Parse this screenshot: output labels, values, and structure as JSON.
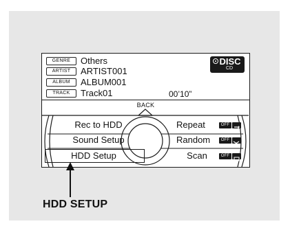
{
  "track_info": {
    "genre_tag": "GENRE",
    "genre": "Others",
    "artist_tag": "ARTIST",
    "artist": "ARTIST001",
    "album_tag": "ALBUM",
    "album": "ALBUM001",
    "track_tag": "TRACK",
    "track": "Track01",
    "time": "00’10”"
  },
  "source_badge": {
    "label": "DISC",
    "sub": "CD",
    "icon": "disc-icon"
  },
  "back_label": "BACK",
  "menu_left": [
    {
      "label": "Rec to HDD"
    },
    {
      "label": "Sound Setup"
    },
    {
      "label": "HDD Setup",
      "selected": true
    }
  ],
  "menu_right": [
    {
      "label": "Repeat",
      "state": "OFF",
      "icon": "repeat-icon"
    },
    {
      "label": "Random",
      "state": "OFF",
      "icon": "shuffle-icon"
    },
    {
      "label": "Scan",
      "state": "OFF",
      "icon": "scan-icon"
    }
  ],
  "callout": {
    "label": "HDD SETUP"
  },
  "colors": {
    "background": "#e7e7e7",
    "screen": "#ffffff",
    "ink": "#1a1a1a"
  }
}
